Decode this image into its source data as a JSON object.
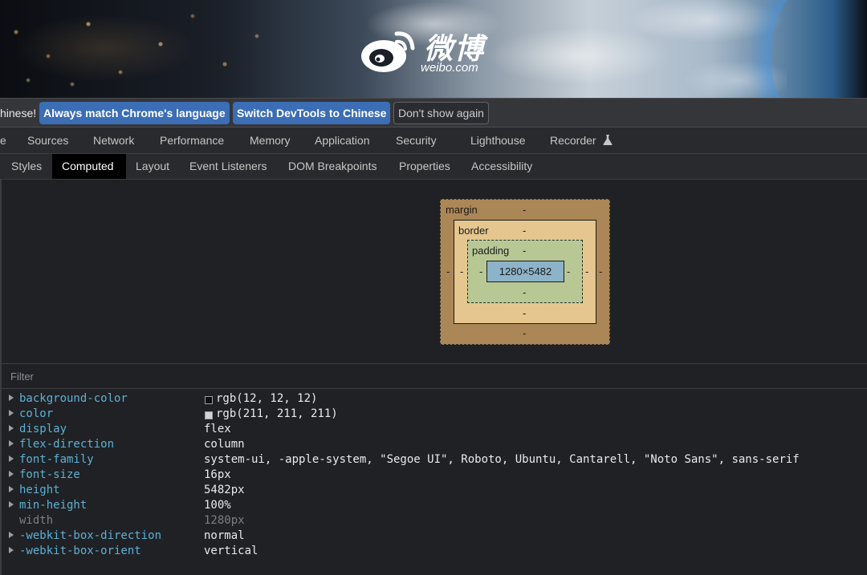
{
  "banner": {
    "logo_cn": "微博",
    "logo_en": "weibo.com"
  },
  "infobar": {
    "message": "hinese!",
    "buttons": [
      "Always match Chrome's language",
      "Switch DevTools to Chinese",
      "Don't show again"
    ]
  },
  "main_tabs": [
    "e",
    "Sources",
    "Network",
    "Performance",
    "Memory",
    "Application",
    "Security",
    "Lighthouse",
    "Recorder"
  ],
  "sub_tabs": [
    "Styles",
    "Computed",
    "Layout",
    "Event Listeners",
    "DOM Breakpoints",
    "Properties",
    "Accessibility"
  ],
  "active_sub_tab": "Computed",
  "box_model": {
    "margin_label": "margin",
    "border_label": "border",
    "padding_label": "padding",
    "content": "1280×5482",
    "dash": "-"
  },
  "filter": {
    "placeholder": "Filter"
  },
  "properties": [
    {
      "name": "background-color",
      "value": "rgb(12, 12, 12)",
      "swatch": "#0c0c0c",
      "expandable": true
    },
    {
      "name": "color",
      "value": "rgb(211, 211, 211)",
      "swatch": "#d3d3d3",
      "expandable": true
    },
    {
      "name": "display",
      "value": "flex",
      "expandable": true
    },
    {
      "name": "flex-direction",
      "value": "column",
      "expandable": true
    },
    {
      "name": "font-family",
      "value": "system-ui, -apple-system, \"Segoe UI\", Roboto, Ubuntu, Cantarell, \"Noto Sans\", sans-serif",
      "expandable": true
    },
    {
      "name": "font-size",
      "value": "16px",
      "expandable": true
    },
    {
      "name": "height",
      "value": "5482px",
      "expandable": true
    },
    {
      "name": "min-height",
      "value": "100%",
      "expandable": true
    },
    {
      "name": "width",
      "value": "1280px",
      "expandable": false,
      "inherited": true
    },
    {
      "name": "-webkit-box-direction",
      "value": "normal",
      "expandable": true
    },
    {
      "name": "-webkit-box-orient",
      "value": "vertical",
      "expandable": true
    }
  ],
  "colors": {
    "panel_bg": "#202124",
    "tab_bar_bg": "#292a2d",
    "primary_button": "#3b6eb5",
    "property_name": "#5db0d7",
    "margin_box": "#ab8657",
    "border_box": "#e5c68e",
    "padding_box": "#b8c894",
    "content_box": "#8cb3c9"
  }
}
